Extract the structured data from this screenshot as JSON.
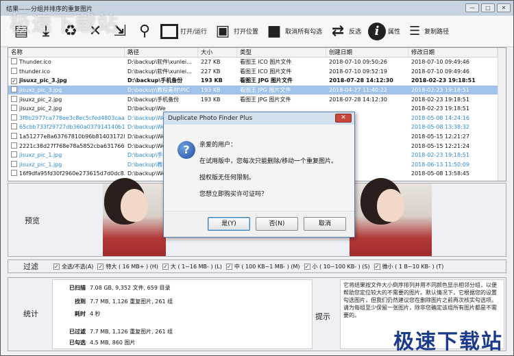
{
  "window": {
    "title": "结果——分组并排序的重复图片",
    "min_glyph": "—",
    "max_glyph": "□",
    "close_glyph": "✕"
  },
  "toolbar": {
    "open_run": "打开/运行",
    "open_location": "打开位置",
    "uncheck_all": "取消所有勾选",
    "invert": "反选",
    "properties": "属性",
    "copy_path": "复制路径",
    "info_glyph": "i"
  },
  "columns": [
    "名称",
    "路径",
    "大小",
    "类型",
    "创建日期",
    "修改日期"
  ],
  "rows": [
    {
      "name": "Thunder.ico",
      "path": "D:\\backup\\软件\\xunlei...",
      "size": "227 KB",
      "type": "看图王 ICO 图片文件",
      "created": "2018-07-10 09:50:26",
      "modified": "2018-07-10 09:49:46",
      "checked": false,
      "style": ""
    },
    {
      "name": "thunder.ico",
      "path": "D:\\backup\\软件\\xunlei...",
      "size": "227 KB",
      "type": "看图王 ICO 图片文件",
      "created": "2018-07-10 09:52:19",
      "modified": "2018-07-10 09:49:46",
      "checked": false,
      "style": ""
    },
    {
      "name": "jisuxz_pic_3.jpg",
      "path": "D:\\backup\\手机备份",
      "size": "193 KB",
      "type": "看图王 JPG 图片文件",
      "created": "2018-07-28 14:12:30",
      "modified": "2018-02-23 19:18:51",
      "checked": true,
      "style": "bold"
    },
    {
      "name": "jisuxz_pic_3.jpg",
      "path": "D:\\backup\\教程素材\\PIC",
      "size": "193 KB",
      "type": "看图王 JPG 图片文件",
      "created": "2018-04-27 11:40:22",
      "modified": "2018-02-23 19:18:51",
      "checked": false,
      "style": "sel"
    },
    {
      "name": "jisuxz_pic_2.jpg",
      "path": "D:\\backup\\手机备份",
      "size": "193 KB",
      "type": "看图王 JPG 图片文件",
      "created": "2018-07-28 14:12:30",
      "modified": "2018-02-23 19:18:51",
      "checked": false,
      "style": ""
    },
    {
      "name": "jisuxz_pic_2.jpg",
      "path": "D:\\backup\\We",
      "size": "",
      "type": "",
      "created": "",
      "modified": "2018-02-23 19:18:51",
      "checked": false,
      "style": ""
    },
    {
      "name": "3f8b2977ca778ee3c8ec5cfed4803caa...",
      "path": "D:\\backup\\We",
      "size": "",
      "type": "",
      "created": "",
      "modified": "2018-05-08 14:24:16",
      "checked": false,
      "style": "blue"
    },
    {
      "name": "65cbb733f29727db360a037914140b1f...",
      "path": "D:\\backup\\We",
      "size": "",
      "type": "",
      "created": "",
      "modified": "2018-05-08 13:38:32",
      "checked": false,
      "style": "blue"
    },
    {
      "name": "1a51277e8a63767810b96b8140317284...",
      "path": "D:\\backup\\We",
      "size": "",
      "type": "",
      "created": "12:21:27",
      "modified": "2018-05-15 12:21:27",
      "checked": false,
      "style": ""
    },
    {
      "name": "2221c38d27f768e78a5852cba631766a...",
      "path": "D:\\backup\\We",
      "size": "",
      "type": "",
      "created": "12:21:24",
      "modified": "2018-05-15 12:21:24",
      "checked": false,
      "style": ""
    },
    {
      "name": "jisuxz_pic_1.jpg",
      "path": "D:\\backup\\手机",
      "size": "",
      "type": "",
      "created": "19:18:51",
      "modified": "2018-02-23 19:18:51",
      "checked": false,
      "style": "blue"
    },
    {
      "name": "jisuxz_pic_1.jpg",
      "path": "D:\\backup\\教程",
      "size": "",
      "type": "",
      "created": "11:40:22",
      "modified": "2018-06-13 11:50:09",
      "checked": false,
      "style": "blue"
    },
    {
      "name": "16f9dfa95fd30f2960e273615d7d0dc8...",
      "path": "D:\\backup\\We",
      "size": "",
      "type": "",
      "created": "",
      "modified": "2018-05-08 13:58:45",
      "checked": false,
      "style": ""
    }
  ],
  "preview": {
    "label": "预览"
  },
  "filter": {
    "label": "过滤",
    "options": [
      "全选/不选(A)",
      "特大 ( 16 MB+ ) (H)",
      "大 ( 1~16 MB- ) (L)",
      "中 ( 100 KB~1 MB- ) (M)",
      "小 ( 10~100 KB- ) (S)",
      "微小 ( 1 B~10 KB- ) (T)"
    ]
  },
  "stats": {
    "label": "统计",
    "scanned_k": "已扫描",
    "scanned_v": "7.08 GB, 9,352 文件, 659 目录",
    "found_k": "找到",
    "found_v": "7.7 MB, 1,126 重复图片, 261 组",
    "time_k": "耗时",
    "time_v": "4 秒",
    "filtered_k": "已过滤",
    "filtered_v": "7.7 MB, 1,126 重复图片, 261 组",
    "checked_k": "已勾选",
    "checked_v": "4.5 MB, 860 图片"
  },
  "hint": {
    "label": "提示",
    "text": "它将结果按文件大小倒序排列并用不同颜色显示相邻分组，以便帮助您定位较大的不需要的图片。默认情况下，它根据您的设置勾选图片，但我们仍然建议您在删除图片之前再次核实勾选项。请为每组至少保留一张图片，除非您确定该组所有图片都是不需要的。"
  },
  "dialog": {
    "title": "Duplicate Photo Finder Plus",
    "close_glyph": "✕",
    "line1": "亲爱的用户：",
    "line2": "在试用版中，您每次只能删除/移动一个重复图片。",
    "line3": "授权版无任何限制。",
    "line4": "您想立即购买许可证吗？",
    "yes": "是(Y)",
    "no": "否(N)",
    "cancel": "取消"
  },
  "watermark": "极速下载站"
}
